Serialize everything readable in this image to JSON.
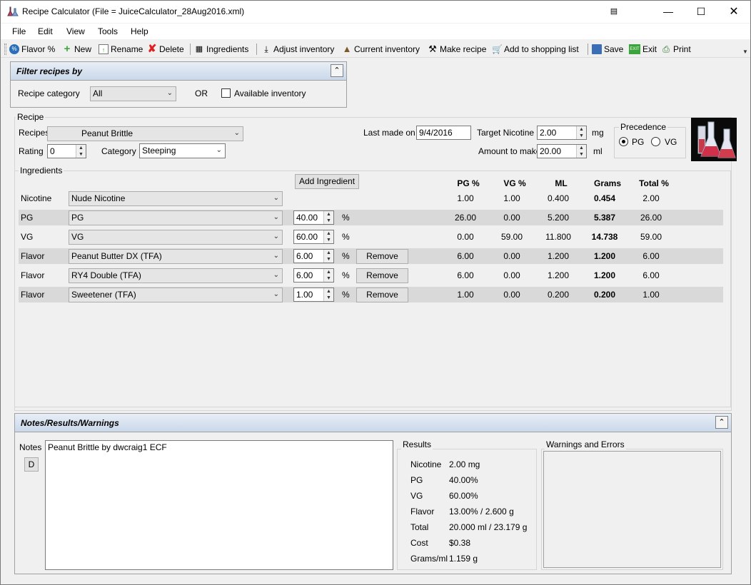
{
  "window": {
    "title": "Recipe Calculator (File = JuiceCalculator_28Aug2016.xml)"
  },
  "menu": [
    "File",
    "Edit",
    "View",
    "Tools",
    "Help"
  ],
  "toolbar": {
    "flavor": "Flavor %",
    "new": "New",
    "rename": "Rename",
    "delete": "Delete",
    "ingredients": "Ingredients",
    "adjust": "Adjust inventory",
    "current": "Current inventory",
    "make": "Make recipe",
    "shopping": "Add to shopping list",
    "save": "Save",
    "exit": "Exit",
    "print": "Print"
  },
  "filter": {
    "title": "Filter recipes by",
    "category_label": "Recipe category",
    "category_value": "All",
    "or": "OR",
    "available_label": "Available inventory"
  },
  "recipe": {
    "group_label": "Recipe",
    "recipes_label": "Recipes",
    "recipe_value": "Peanut Brittle",
    "rating_label": "Rating",
    "rating_value": "0",
    "category_label": "Category",
    "category_value": "Steeping",
    "last_made_label": "Last made on",
    "last_made_value": "9/4/2016",
    "target_nic_label": "Target Nicotine",
    "target_nic_value": "2.00",
    "target_nic_unit": "mg",
    "amount_label": "Amount to make",
    "amount_value": "20.00",
    "amount_unit": "ml",
    "precedence_label": "Precedence",
    "pg_label": "PG",
    "vg_label": "VG"
  },
  "ingredients": {
    "group_label": "Ingredients",
    "add_button": "Add Ingredient",
    "headers": {
      "pg": "PG %",
      "vg": "VG %",
      "ml": "ML",
      "grams": "Grams",
      "total": "Total %"
    },
    "percent_sign": "%",
    "remove_label": "Remove",
    "rows": [
      {
        "type": "Nicotine",
        "name": "Nude Nicotine",
        "pct": "",
        "pg": "1.00",
        "vg": "1.00",
        "ml": "0.400",
        "grams": "0.454",
        "total": "2.00"
      },
      {
        "type": "PG",
        "name": "PG",
        "pct": "40.00",
        "pg": "26.00",
        "vg": "0.00",
        "ml": "5.200",
        "grams": "5.387",
        "total": "26.00"
      },
      {
        "type": "VG",
        "name": "VG",
        "pct": "60.00",
        "pg": "0.00",
        "vg": "59.00",
        "ml": "11.800",
        "grams": "14.738",
        "total": "59.00"
      },
      {
        "type": "Flavor",
        "name": "Peanut Butter DX (TFA)",
        "pct": "6.00",
        "pg": "6.00",
        "vg": "0.00",
        "ml": "1.200",
        "grams": "1.200",
        "total": "6.00"
      },
      {
        "type": "Flavor",
        "name": "RY4 Double (TFA)",
        "pct": "6.00",
        "pg": "6.00",
        "vg": "0.00",
        "ml": "1.200",
        "grams": "1.200",
        "total": "6.00"
      },
      {
        "type": "Flavor",
        "name": "Sweetener (TFA)",
        "pct": "1.00",
        "pg": "1.00",
        "vg": "0.00",
        "ml": "0.200",
        "grams": "0.200",
        "total": "1.00"
      }
    ]
  },
  "notes": {
    "title": "Notes/Results/Warnings",
    "notes_label": "Notes",
    "d_button": "D",
    "notes_text": "Peanut Brittle by dwcraig1 ECF",
    "results_label": "Results",
    "results": [
      {
        "k": "Nicotine",
        "v": "2.00 mg"
      },
      {
        "k": "PG",
        "v": "40.00%"
      },
      {
        "k": "VG",
        "v": "60.00%"
      },
      {
        "k": "Flavor",
        "v": "13.00% / 2.600 g"
      },
      {
        "k": "Total",
        "v": "20.000 ml / 23.179 g"
      },
      {
        "k": "Cost",
        "v": "$0.38"
      },
      {
        "k": "Grams/ml",
        "v": "1.159 g"
      }
    ],
    "warnings_label": "Warnings and Errors"
  }
}
